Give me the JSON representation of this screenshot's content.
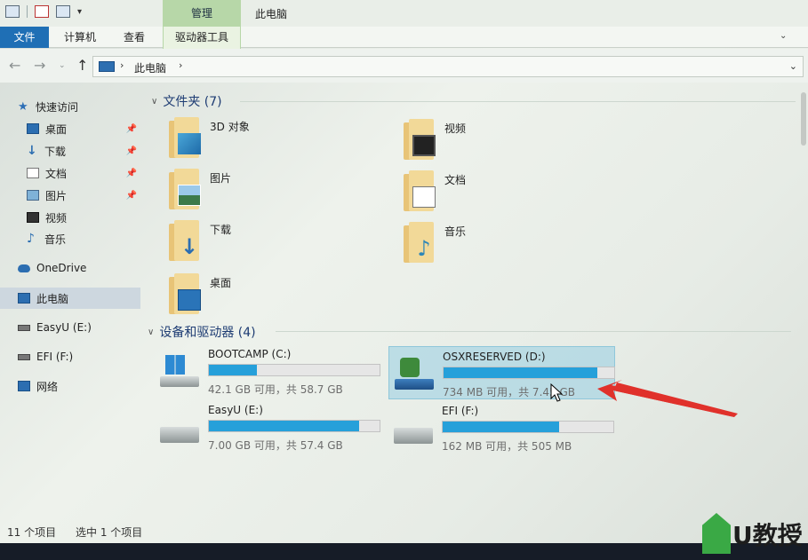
{
  "window": {
    "title": "此电脑",
    "contextual_tab": "管理"
  },
  "ribbon": {
    "tabs": [
      "文件",
      "计算机",
      "查看",
      "驱动器工具"
    ]
  },
  "address": {
    "path": "此电脑"
  },
  "sidebar": {
    "items": [
      {
        "label": "快速访问",
        "icon": "star-icon"
      },
      {
        "label": "桌面",
        "icon": "desktop-icon",
        "pinned": true
      },
      {
        "label": "下载",
        "icon": "download-icon",
        "pinned": true
      },
      {
        "label": "文档",
        "icon": "document-icon",
        "pinned": true
      },
      {
        "label": "图片",
        "icon": "picture-icon",
        "pinned": true
      },
      {
        "label": "视频",
        "icon": "video-icon"
      },
      {
        "label": "音乐",
        "icon": "music-icon"
      },
      {
        "label": "OneDrive",
        "icon": "cloud-icon"
      },
      {
        "label": "此电脑",
        "icon": "computer-icon",
        "selected": true
      },
      {
        "label": "EasyU (E:)",
        "icon": "usb-drive-icon"
      },
      {
        "label": "EFI (F:)",
        "icon": "usb-drive-icon"
      },
      {
        "label": "网络",
        "icon": "network-icon"
      }
    ]
  },
  "folders_section": {
    "title": "文件夹 (7)",
    "items": [
      {
        "label": "3D 对象",
        "icon": "3d-objects-icon"
      },
      {
        "label": "视频",
        "icon": "video-icon"
      },
      {
        "label": "图片",
        "icon": "picture-icon"
      },
      {
        "label": "文档",
        "icon": "document-icon"
      },
      {
        "label": "下载",
        "icon": "download-icon"
      },
      {
        "label": "音乐",
        "icon": "music-icon"
      },
      {
        "label": "桌面",
        "icon": "desktop-icon"
      }
    ]
  },
  "drives_section": {
    "title": "设备和驱动器 (4)",
    "items": [
      {
        "name": "BOOTCAMP (C:)",
        "space": "42.1 GB 可用，共 58.7 GB",
        "used_fraction": 0.28,
        "icon": "windows-drive-icon"
      },
      {
        "name": "OSXRESERVED (D:)",
        "space": "734 MB 可用，共 7.45 GB",
        "used_fraction": 0.9,
        "icon": "recovery-drive-icon",
        "selected": true
      },
      {
        "name": "EasyU (E:)",
        "space": "7.00 GB 可用，共 57.4 GB",
        "used_fraction": 0.88,
        "icon": "usb-drive-icon"
      },
      {
        "name": "EFI (F:)",
        "space": "162 MB 可用，共 505 MB",
        "used_fraction": 0.68,
        "icon": "usb-drive-icon"
      }
    ]
  },
  "status": {
    "count": "11 个项目",
    "selected": "选中 1 个项目"
  },
  "watermark": {
    "text": "U教授"
  },
  "colors": {
    "accent": "#1f6fb5",
    "manage_tab": "#b7d7a8",
    "drive_bar": "#26a0da",
    "arrow": "#e0312b"
  }
}
